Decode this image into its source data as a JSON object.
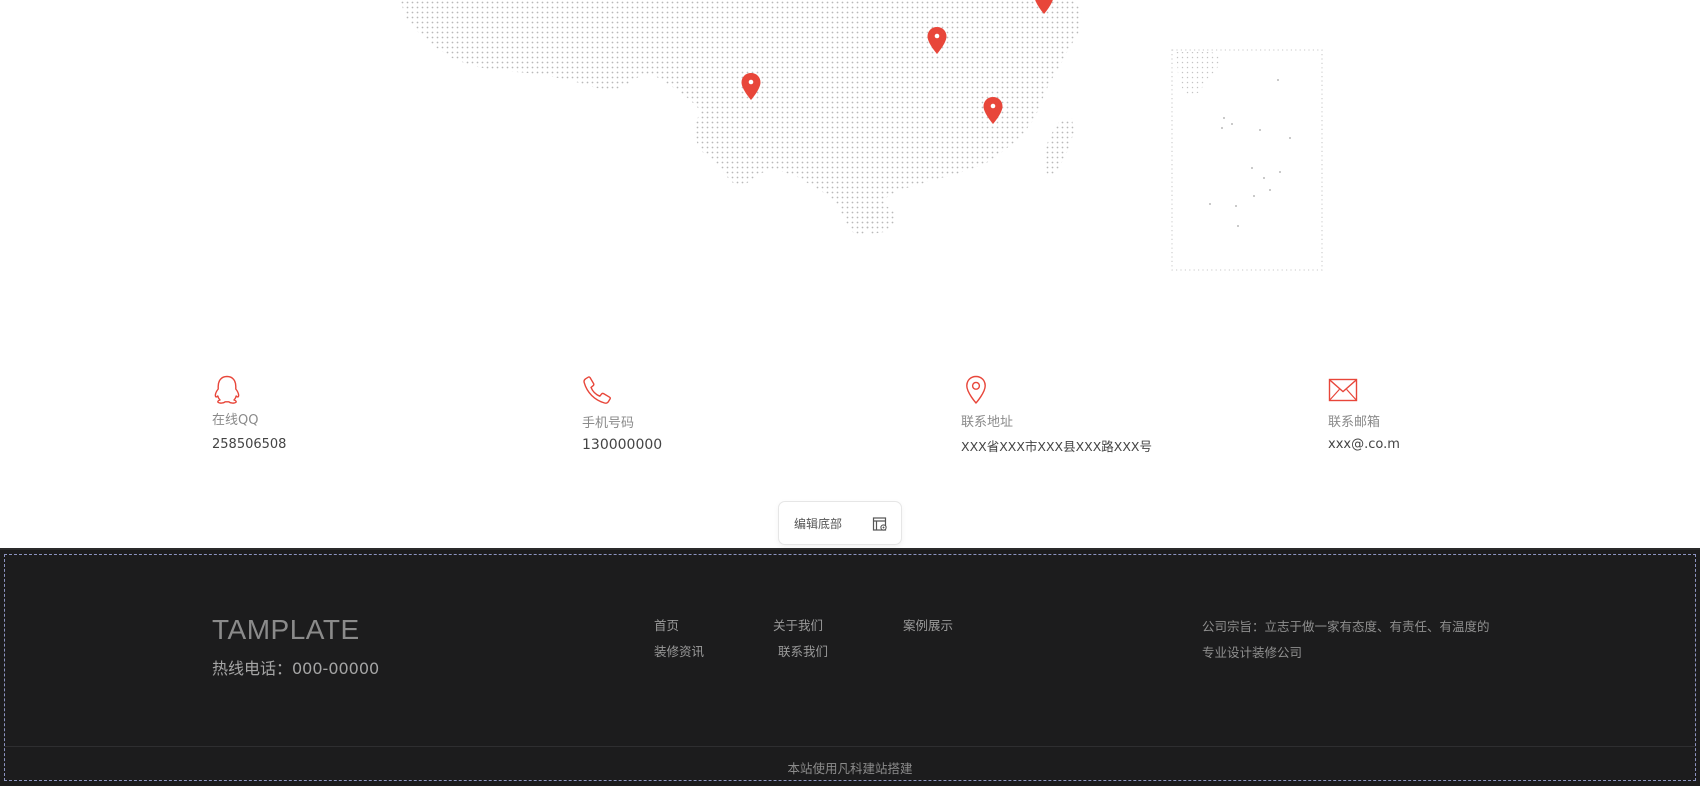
{
  "map": {
    "pins": [
      {
        "name": "map-pin-1"
      },
      {
        "name": "map-pin-2"
      },
      {
        "name": "map-pin-3"
      },
      {
        "name": "map-pin-4"
      }
    ],
    "pin_color": "#e8463a",
    "dot_color": "#b9b9b9"
  },
  "contacts": [
    {
      "icon": "qq-penguin-icon",
      "label": "在线QQ",
      "value": "258506508"
    },
    {
      "icon": "phone-icon",
      "label": "手机号码",
      "value": "130000000"
    },
    {
      "icon": "location-pin-icon",
      "label": "联系地址",
      "value": "XXX省XXX市XXX县XXX路XXX号"
    },
    {
      "icon": "mail-icon",
      "label": "联系邮箱",
      "value": "xxx@.co.m"
    }
  ],
  "edit_footer": {
    "label": "编辑底部",
    "icon": "edit-footer-icon"
  },
  "footer": {
    "brand": "TAMPLATE",
    "hotline": "热线电话：000-00000",
    "nav": [
      {
        "label": "首页"
      },
      {
        "label": "关于我们"
      },
      {
        "label": "案例展示"
      },
      {
        "label": "装修资讯"
      },
      {
        "label": "联系我们"
      }
    ],
    "motto_line1": "公司宗旨：立志于做一家有态度、有责任、有温度的",
    "motto_line2": "专业设计装修公司",
    "copyright": "本站使用凡科建站搭建"
  },
  "colors": {
    "accent": "#e8463a",
    "footer_bg": "#1c1c1d",
    "frame_dash": "#8c93bf"
  }
}
